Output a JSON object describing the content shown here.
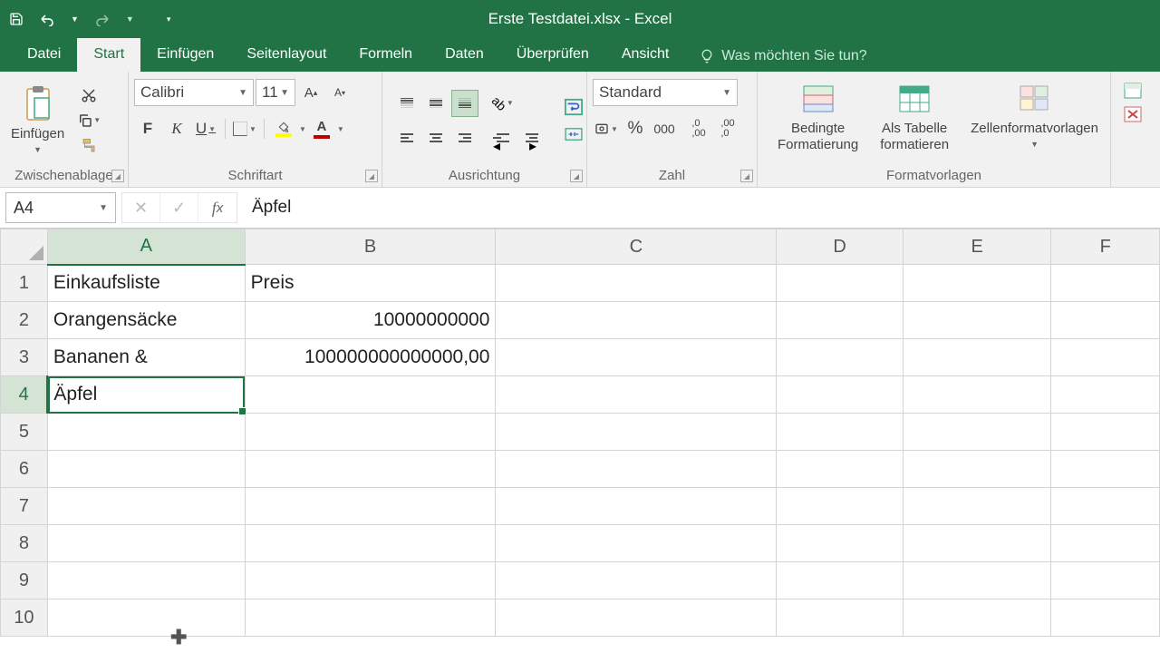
{
  "title": "Erste Testdatei.xlsx - Excel",
  "qat": {
    "undo_tip": "↶",
    "redo_tip": "↷"
  },
  "tabs": {
    "file": "Datei",
    "start": "Start",
    "insert": "Einfügen",
    "pagelayout": "Seitenlayout",
    "formulas": "Formeln",
    "data": "Daten",
    "review": "Überprüfen",
    "view": "Ansicht",
    "tellme": "Was möchten Sie tun?"
  },
  "ribbon": {
    "clipboard": {
      "paste": "Einfügen",
      "label": "Zwischenablage"
    },
    "font": {
      "name": "Calibri",
      "size": "11",
      "bold": "F",
      "italic": "K",
      "underline": "U",
      "label": "Schriftart"
    },
    "alignment": {
      "label": "Ausrichtung"
    },
    "number": {
      "format": "Standard",
      "label": "Zahl"
    },
    "styles": {
      "conditional": "Bedingte\nFormatierung",
      "table": "Als Tabelle\nformatieren",
      "cellstyles": "Zellenformatvorlagen",
      "label": "Formatvorlagen"
    }
  },
  "namebox": "A4",
  "formula": "Äpfel",
  "columns": [
    "A",
    "B",
    "C",
    "D",
    "E",
    "F"
  ],
  "rows": [
    "1",
    "2",
    "3",
    "4",
    "5",
    "6",
    "7",
    "8",
    "9",
    "10"
  ],
  "cells": {
    "A1": "Einkaufsliste",
    "B1": "Preis",
    "A2": "Orangensäcke",
    "B2": "10000000000",
    "A3": "Bananen &",
    "B3": "100000000000000,00",
    "A4": "Äpfel"
  },
  "active": {
    "col": "A",
    "row": "4"
  },
  "chart_data": null
}
